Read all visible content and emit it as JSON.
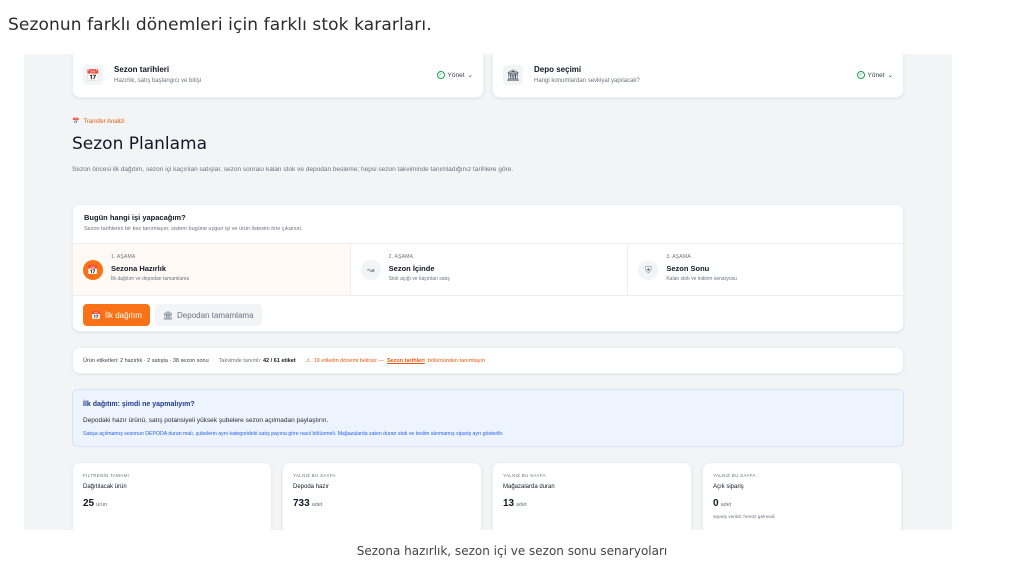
{
  "heading": "Sezonun farklı dönemleri için farklı stok kararları.",
  "caption": "Sezona hazırlık, sezon içi ve sezon sonu senaryoları",
  "top_cards": [
    {
      "icon": "calendar-icon",
      "title": "Sezon tarihleri",
      "subtitle": "Hazırlık, satış başlangıcı ve bitişi",
      "action": "Yönet"
    },
    {
      "icon": "warehouse-icon",
      "title": "Depo seçimi",
      "subtitle": "Hangi konumlardan sevkiyat yapılacak?",
      "action": "Yönet"
    }
  ],
  "breadcrumb": "Transfer Analizi",
  "page_title": "Sezon Planlama",
  "page_description": "Sezon öncesi ilk dağıtım, sezon içi kaçırılan satışlar, sezon sonrası kalan stok ve depodan besleme; hepsi sezon takviminde tanımladığınız tarihlere göre.",
  "today": {
    "title": "Bugün hangi işi yapacağım?",
    "subtitle": "Sezon tarihlerini bir kez tanımlayın; sistem bugüne uygun işi ve ürün listesini öne çıkarsın.",
    "stages": [
      {
        "step": "1. AŞAMA",
        "name": "Sezona Hazırlık",
        "desc": "İlk dağıtım ve depodan tamamlama",
        "icon": "calendar-icon",
        "active": true
      },
      {
        "step": "2. AŞAMA",
        "name": "Sezon İçinde",
        "desc": "Stok açığı ve kaçırılan satış",
        "icon": "trend-icon",
        "active": false
      },
      {
        "step": "3. AŞAMA",
        "name": "Sezon Sonu",
        "desc": "Kalan stok ve indirim senaryosu",
        "icon": "shield-icon",
        "active": false
      }
    ],
    "buttons": [
      {
        "label": "İlk dağıtım",
        "icon": "calendar-icon"
      },
      {
        "label": "Depodan tamamlama",
        "icon": "warehouse-icon"
      }
    ]
  },
  "tags_bar": {
    "summary": "Ürün etiketleri: 2 hazırlık · 2 satışta · 38 sezon sonu",
    "defined_prefix": "Takvimde tanımlı:",
    "defined_value": "42 / 61 etiket",
    "warning_prefix": "19 etiketin dönemi belirsiz —",
    "warning_link": "Sezon tarihleri",
    "warning_suffix": "bölümünden tanımlayın"
  },
  "info": {
    "title": "İlk dağıtım: şimdi ne yapmalıyım?",
    "text": "Depodaki hazır ürünü, satış potansiyeli yüksek şubelere sezon açılmadan paylaştırın.",
    "small": "Satışa açılmamış sezonun DEPODA duran malı, şubelerin aynı kategorideki satış payına göre nasıl bölünmeli. Mağazalarda zaten duran stok ve teslim alınmamış sipariş ayrı gösterilir."
  },
  "metrics": [
    {
      "kicker": "FİLTRENİN TAMAMI",
      "label": "Dağıtılacak ürün",
      "value": "25",
      "unit": "ürün",
      "note": ""
    },
    {
      "kicker": "YALNIZ BU SAYFA",
      "label": "Depoda hazır",
      "value": "733",
      "unit": "adet",
      "note": ""
    },
    {
      "kicker": "YALNIZ BU SAYFA",
      "label": "Mağazalarda duran",
      "value": "13",
      "unit": "adet",
      "note": ""
    },
    {
      "kicker": "YALNIZ BU SAYFA",
      "label": "Açık sipariş",
      "value": "0",
      "unit": "adet",
      "note": "sipariş verildi; henüz gelmedi"
    }
  ],
  "colors": {
    "accent": "#f97316",
    "info_bg": "#eef4fd",
    "success": "#16a34a"
  }
}
